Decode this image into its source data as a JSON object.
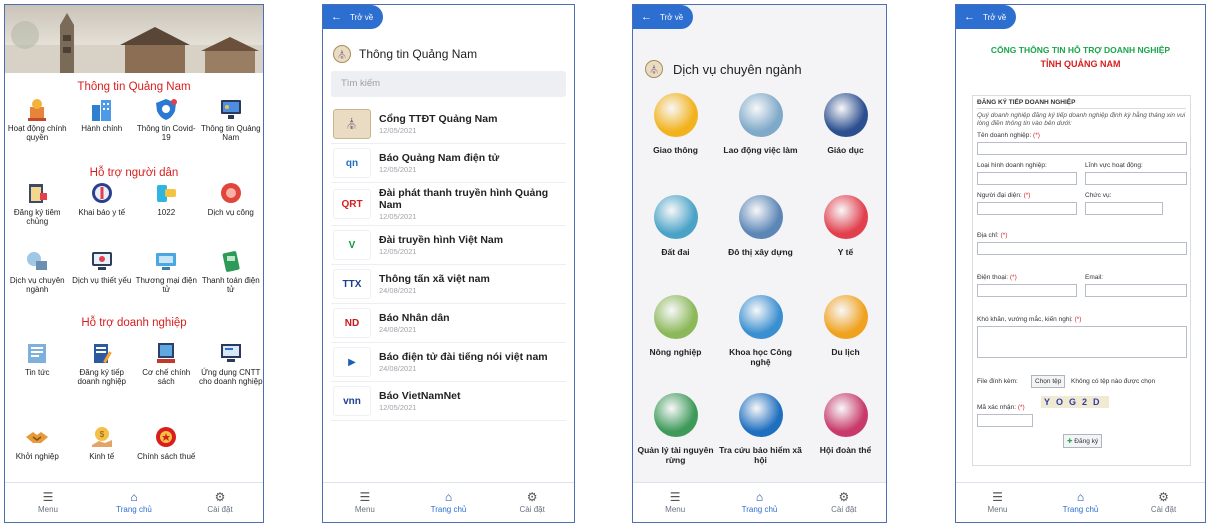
{
  "bottom_nav": {
    "menu": "Menu",
    "home": "Trang chủ",
    "settings": "Cài đặt"
  },
  "back_label": "Trở về",
  "screen1": {
    "sections": [
      {
        "title": "Thông tin Quảng Nam",
        "items": [
          "Hoạt động chính quyền",
          "Hành chính",
          "Thông tin Covid-19",
          "Thông tin Quảng Nam"
        ]
      },
      {
        "title": "Hỗ trợ người dân",
        "items": [
          "Đăng ký tiêm chủng",
          "Khai báo y tế",
          "1022",
          "Dịch vụ công",
          "Dịch vụ chuyên ngành",
          "Dịch vụ thiết yếu",
          "Thương mại điện tử",
          "Thanh toán điện tử"
        ]
      },
      {
        "title": "Hỗ trợ doanh nghiệp",
        "items": [
          "Tin tức",
          "Đăng ký tiếp doanh nghiệp",
          "Cơ chế chính sách",
          "Ứng dụng CNTT cho doanh nghiệp",
          "Khởi nghiệp",
          "Kinh tế",
          "Chính sách thuế"
        ]
      }
    ]
  },
  "screen2": {
    "title": "Thông tin Quảng Nam",
    "search_placeholder": "Tìm kiếm",
    "news": [
      {
        "title": "Cổng TTĐT Quảng Nam",
        "date": "12/05/2021",
        "logo": "seal",
        "logo_color": "#e9dcc3"
      },
      {
        "title": "Báo Quảng Nam điện tử",
        "date": "12/05/2021",
        "logo": "qn",
        "logo_color": "#1e6fc2"
      },
      {
        "title": "Đài phát thanh truyền hình Quảng Nam",
        "date": "12/05/2021",
        "logo": "qrt",
        "logo_color": "#d61e1e"
      },
      {
        "title": "Đài truyền hình Việt Nam",
        "date": "12/05/2021",
        "logo": "vtv",
        "logo_color": "#0a9a3a"
      },
      {
        "title": "Thông tấn xã việt nam",
        "date": "24/08/2021",
        "logo": "ttx",
        "logo_color": "#1f3b8f"
      },
      {
        "title": "Báo Nhân dân",
        "date": "24/08/2021",
        "logo": "nd",
        "logo_color": "#c8161d"
      },
      {
        "title": "Báo điện tử đài tiếng nói việt nam",
        "date": "24/08/2021",
        "logo": "vov",
        "logo_color": "#1c5fb4"
      },
      {
        "title": "Báo VietNamNet",
        "date": "12/05/2021",
        "logo": "vnn",
        "logo_color": "#1d3f8c"
      }
    ]
  },
  "screen3": {
    "title": "Dịch vụ chuyên ngành",
    "services": [
      {
        "label": "Giao thông",
        "color": "#f2b21b"
      },
      {
        "label": "Lao động việc làm",
        "color": "#7fa9c9"
      },
      {
        "label": "Giáo dục",
        "color": "#2c4f8f"
      },
      {
        "label": "Đất đai",
        "color": "#4aa3c7"
      },
      {
        "label": "Đô thị xây dựng",
        "color": "#5b86b6"
      },
      {
        "label": "Y tế",
        "color": "#e2404e"
      },
      {
        "label": "Nông nghiệp",
        "color": "#8cb85a"
      },
      {
        "label": "Khoa học Công nghệ",
        "color": "#3a8fd0"
      },
      {
        "label": "Du lịch",
        "color": "#f0a21f"
      },
      {
        "label": "Quản lý tài nguyên rừng",
        "color": "#3f9a5a"
      },
      {
        "label": "Tra cứu bảo hiểm xã hội",
        "color": "#1f6fbf"
      },
      {
        "label": "Hội đoàn thể",
        "color": "#c83a6a"
      }
    ]
  },
  "screen4": {
    "heading1": "CỔNG THÔNG TIN HỖ TRỢ DOANH NGHIỆP",
    "heading2": "TỈNH QUẢNG NAM",
    "form_title": "ĐĂNG KÝ TIẾP DOANH NGHIỆP",
    "form_note": "Quý doanh nghiệp đăng ký tiếp doanh nghiệp định kỳ hằng tháng xin vui lòng điền thông tin vào bên dưới:",
    "labels": {
      "company": "Tên doanh nghiệp:",
      "type": "Loại hình doanh nghiệp:",
      "field": "Lĩnh vực hoạt động:",
      "rep": "Người đại diện:",
      "position": "Chức vụ:",
      "address": "Địa chỉ:",
      "phone": "Điện thoại:",
      "email": "Email:",
      "difficulty": "Khó khăn, vướng mắc, kiến nghị:",
      "attach": "File đính kèm:",
      "choose": "Chọn tệp",
      "no_file": "Không có tệp nào được chọn",
      "captcha_label": "Mã xác nhận:",
      "register": "Đăng ký"
    },
    "required_mark": "(*)",
    "captcha": "YOG2D"
  }
}
